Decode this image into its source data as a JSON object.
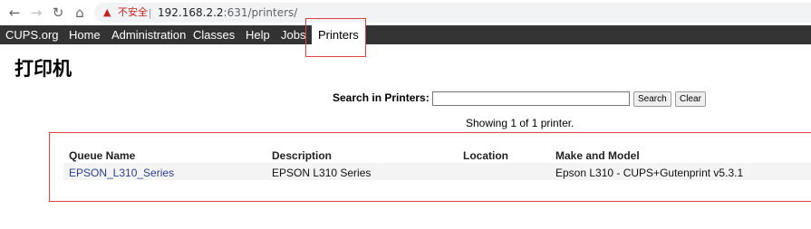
{
  "browser": {
    "back_icon": "arrow-left-icon",
    "forward_icon": "arrow-right-icon",
    "reload_icon": "reload-icon",
    "home_icon": "home-icon",
    "security_icon": "warning-triangle-icon",
    "security_text": "不安全",
    "url_host": "192.168.2.2",
    "url_rest": ":631/printers/"
  },
  "nav": {
    "items": [
      {
        "label": "CUPS.org"
      },
      {
        "label": "Home"
      },
      {
        "label": "Administration"
      },
      {
        "label": "Classes"
      },
      {
        "label": "Help"
      },
      {
        "label": "Jobs"
      },
      {
        "label": "Printers"
      }
    ],
    "active": "Printers",
    "bar_color": "#333333"
  },
  "page": {
    "title": "打印机"
  },
  "search": {
    "label": "Search in Printers:",
    "value": "",
    "search_button": "Search",
    "clear_button": "Clear"
  },
  "status": {
    "showing": "Showing 1 of 1 printer."
  },
  "table": {
    "headers": [
      "Queue Name",
      "Description",
      "Location",
      "Make and Model"
    ],
    "rows": [
      [
        "EPSON_L310_Series",
        "EPSON L310 Series",
        "",
        "Epson L310 - CUPS+Gutenprint v5.3.1"
      ]
    ]
  },
  "colors": {
    "highlight": "#e0413e",
    "link": "#2b3f8f"
  }
}
